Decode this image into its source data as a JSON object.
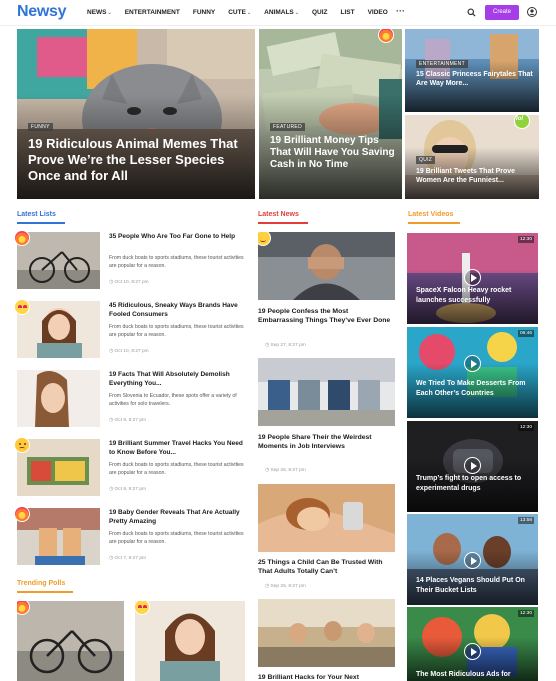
{
  "header": {
    "logo": "Newsy",
    "nav": [
      {
        "label": "NEWS",
        "caret": "⌄"
      },
      {
        "label": "ENTERTAINMENT",
        "caret": ""
      },
      {
        "label": "FUNNY",
        "caret": ""
      },
      {
        "label": "CUTE",
        "caret": "⌄"
      },
      {
        "label": "ANIMALS",
        "caret": "⌄"
      },
      {
        "label": "QUIZ",
        "caret": ""
      },
      {
        "label": "LIST",
        "caret": ""
      },
      {
        "label": "VIDEO",
        "caret": ""
      }
    ],
    "more": "···",
    "create_label": "Create",
    "accent": "#a63ee8",
    "logo_color": "#2f74d6"
  },
  "hero": {
    "main": {
      "badge": "FUNNY",
      "title": "19 Ridiculous Animal Memes That Prove We’re the Lesser Species Once and for All"
    },
    "middle": {
      "badge": "FEATURED",
      "title": "19 Brilliant Money Tips That Will Have You Saving Cash in No Time"
    },
    "right_top": {
      "badge": "ENTERTAINMENT",
      "title": "15 Classic Princess Fairytales That Are Way More..."
    },
    "right_bottom": {
      "badge": "QUIZ",
      "title": "19 Brilliant Tweets That Prove Women Are the Funniest..."
    }
  },
  "sections": {
    "latest_lists": "Latest Lists",
    "latest_news": "Latest News",
    "latest_videos": "Latest Videos",
    "trending_polls": "Trending Polls"
  },
  "section_colors": {
    "lists": "#2f74d6",
    "news": "#e33c3c",
    "videos": "#f29b2a",
    "polls": "#f29b2a"
  },
  "latest_lists": [
    {
      "title": "35 People Who Are Too Far Gone to Help",
      "desc": "From duck boats to sports stadiums, these tourist activities are popular for a reason.",
      "date": "Oct 10, 8:27 pm",
      "emoji": "fire"
    },
    {
      "title": "45 Ridiculous, Sneaky Ways Brands Have Fooled Consumers",
      "desc": "From duck boats to sports stadiums, these tourist activities are popular for a reason.",
      "date": "Oct 10, 8:27 pm",
      "emoji": "heart"
    },
    {
      "title": "19 Facts That Will Absolutely Demolish Everything You...",
      "desc": "From Slovenia to Ecuador, these spots offer a variety of activities for solo travelers.",
      "date": "Oct 9, 8:27 pm",
      "emoji": ""
    },
    {
      "title": "19 Brilliant Summer Travel Hacks You Need to Know Before You...",
      "desc": "From duck boats to sports stadiums, these tourist activities are popular for a reason.",
      "date": "Oct 8, 8:27 pm",
      "emoji": "sad"
    },
    {
      "title": "19 Baby Gender Reveals That Are Actually Pretty Amazing",
      "desc": "From duck boats to sports stadiums, these tourist activities are popular for a reason.",
      "date": "Oct 7, 8:27 pm",
      "emoji": "fire"
    }
  ],
  "latest_news": [
    {
      "title": "19 People Confess the Most Embarrassing Things They’ve Ever Done",
      "date": "Sep 27, 8:27 pm",
      "emoji": "smile"
    },
    {
      "title": "19 People Share Their the Weirdest Moments in Job Interviews",
      "date": "Sep 26, 8:27 pm",
      "emoji": ""
    },
    {
      "title": "25 Things a Child Can Be Trusted With That Adults Totally Can’t",
      "date": "Sep 25, 8:27 pm",
      "emoji": ""
    },
    {
      "title": "19 Brilliant Hacks for Your Next",
      "date": "",
      "emoji": ""
    }
  ],
  "latest_videos": [
    {
      "title": "SpaceX Falcon Heavy rocket launches successfully",
      "duration": "12:30"
    },
    {
      "title": "We Tried To Make Desserts From Each Other’s Countries",
      "duration": "06:46"
    },
    {
      "title": "Trump’s fight to open access to experimental drugs",
      "duration": "12:30"
    },
    {
      "title": "14 Places Vegans Should Put On Their Bucket Lists",
      "duration": "13:58"
    },
    {
      "title": "The Most Ridiculous Ads for",
      "duration": "12:30"
    }
  ]
}
